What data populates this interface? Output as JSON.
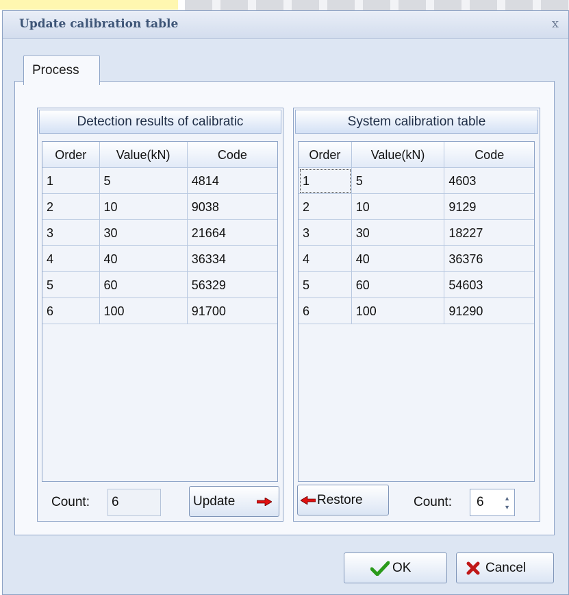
{
  "dialog": {
    "title": "Update calibration table",
    "close_label": "x"
  },
  "tabs": [
    {
      "label": "Process"
    }
  ],
  "left_panel": {
    "title": "Detection results of calibratic",
    "columns": [
      "Order",
      "Value(kN)",
      "Code"
    ],
    "rows": [
      [
        "1",
        "5",
        "4814"
      ],
      [
        "2",
        "10",
        "9038"
      ],
      [
        "3",
        "30",
        "21664"
      ],
      [
        "4",
        "40",
        "36334"
      ],
      [
        "5",
        "60",
        "56329"
      ],
      [
        "6",
        "100",
        "91700"
      ]
    ],
    "count_label": "Count:",
    "count_value": "6",
    "update_label": "Update"
  },
  "right_panel": {
    "title": "System calibration table",
    "columns": [
      "Order",
      "Value(kN)",
      "Code"
    ],
    "rows": [
      [
        "1",
        "5",
        "4603"
      ],
      [
        "2",
        "10",
        "9129"
      ],
      [
        "3",
        "30",
        "18227"
      ],
      [
        "4",
        "40",
        "36376"
      ],
      [
        "5",
        "60",
        "54603"
      ],
      [
        "6",
        "100",
        "91290"
      ]
    ],
    "restore_label": "Restore",
    "count_label": "Count:",
    "count_value": "6"
  },
  "buttons": {
    "ok_label": "OK",
    "cancel_label": "Cancel"
  },
  "colors": {
    "accent_red": "#e01010",
    "ok_green": "#2a9a1a",
    "cancel_red": "#c01818"
  },
  "icons": {
    "update": "right-arrow-icon",
    "restore": "left-arrow-icon",
    "ok": "check-icon",
    "cancel": "x-icon"
  }
}
